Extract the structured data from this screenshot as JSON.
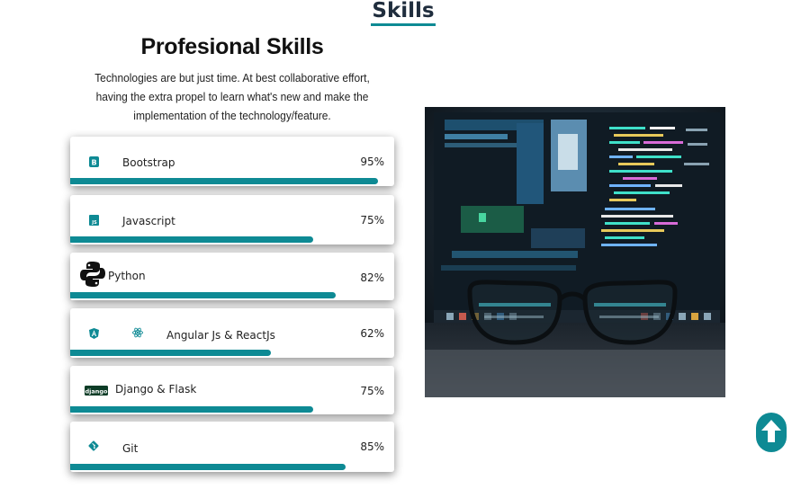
{
  "section": {
    "title": "Skills"
  },
  "profesional": {
    "title": "Profesional Skills",
    "description": "Technologies are but just time. At best collaborative effort, having the extra propel to learn what's new and make the implementation of the technology/feature."
  },
  "skills": [
    {
      "name": "Bootstrap",
      "percent_label": "95%",
      "percent": 95,
      "icon": "bootstrap-icon"
    },
    {
      "name": "Javascript",
      "percent_label": "75%",
      "percent": 75,
      "icon": "javascript-icon"
    },
    {
      "name": "Python",
      "percent_label": "82%",
      "percent": 82,
      "icon": "python-icon"
    },
    {
      "name": "Angular Js & ReactJs",
      "percent_label": "62%",
      "percent": 62,
      "icon": "angular-icon"
    },
    {
      "name": "Django & Flask",
      "percent_label": "75%",
      "percent": 75,
      "icon": "django-icon"
    },
    {
      "name": "Git",
      "percent_label": "85%",
      "percent": 85,
      "icon": "git-icon"
    }
  ],
  "icon_labels": {
    "javascript": "JS",
    "django": "django",
    "bootstrap": "B"
  },
  "colors": {
    "accent": "#0e8a94",
    "title": "#1f2d3d",
    "text": "#222222"
  },
  "photo": {
    "description_icon": "code-screen-glasses-image"
  },
  "scroll_top": {
    "icon": "arrow-up-icon"
  }
}
